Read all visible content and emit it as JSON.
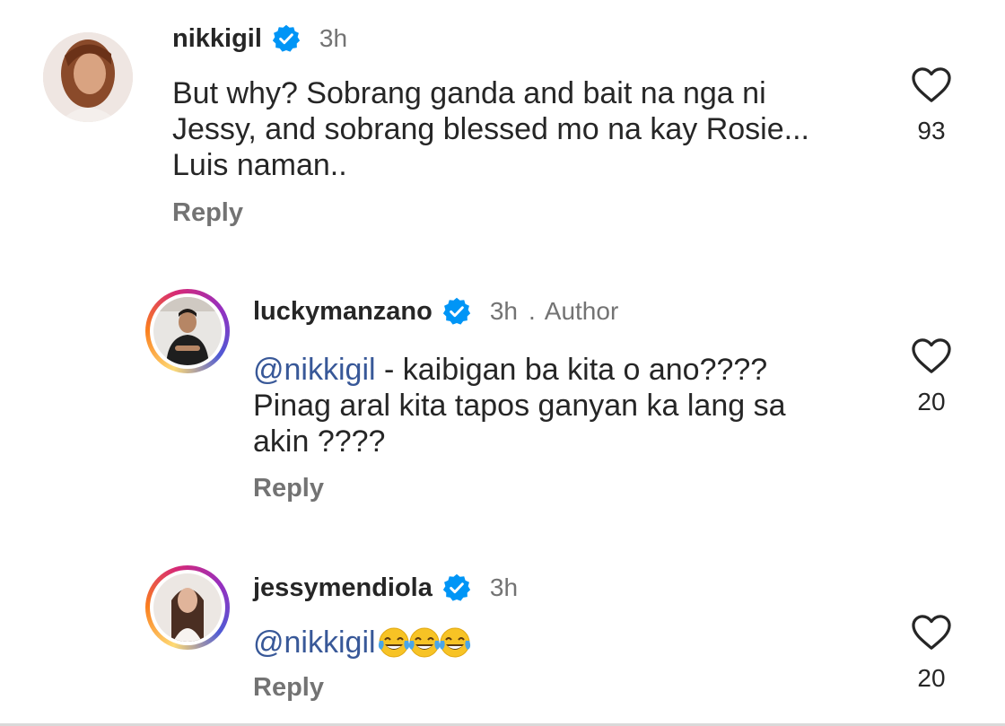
{
  "comments": [
    {
      "username": "nikkigil",
      "time": "3h",
      "lines": [
        "But why? Sobrang ganda and bait na nga ni",
        "Jessy, and sobrang blessed mo na kay Rosie...",
        "Luis naman.."
      ],
      "reply_label": "Reply",
      "likes": "93"
    },
    {
      "username": "luckymanzano",
      "time": "3h",
      "dot": ".",
      "badge": "Author",
      "mention": "@nikkigil",
      "lines": [
        " - kaibigan ba kita o ano????",
        "Pinag aral kita tapos ganyan ka lang sa",
        "akin ????"
      ],
      "reply_label": "Reply",
      "likes": "20"
    },
    {
      "username": "jessymendiola",
      "time": "3h",
      "mention": "@nikkigil",
      "emojis": [
        "face-with-tears-of-joy",
        "face-with-tears-of-joy",
        "face-with-tears-of-joy"
      ],
      "reply_label": "Reply",
      "likes": "20"
    }
  ],
  "icons": {
    "verified": "verified-badge-icon",
    "like": "heart-outline-icon"
  },
  "colors": {
    "verified": "#0095f6",
    "mention": "#385898",
    "meta": "#737373"
  }
}
